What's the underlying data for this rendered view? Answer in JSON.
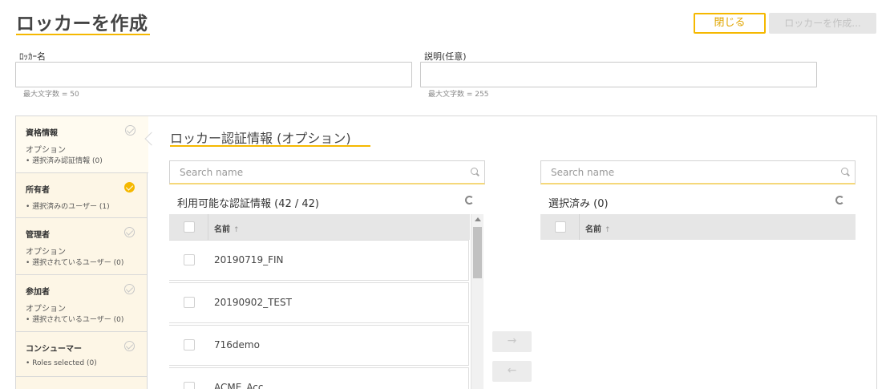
{
  "header": {
    "title": "ロッカーを作成",
    "close_label": "閉じる",
    "create_label": "ロッカーを作成..."
  },
  "form": {
    "name_label": "ﾛｯｶｰ名",
    "name_value": "",
    "name_hint": "最大文字数 = 50",
    "desc_label": "説明(任意)",
    "desc_value": "",
    "desc_hint": "最大文字数 = 255"
  },
  "sidebar": {
    "items": [
      {
        "title": "資格情報",
        "sub": "オプション",
        "detail": "• 選択済み認証情報 (0)",
        "status": "pending"
      },
      {
        "title": "所有者",
        "sub": "",
        "detail": "• 選択済みのユーザー (1)",
        "status": "done"
      },
      {
        "title": "管理者",
        "sub": "オプション",
        "detail": "• 選択されているユーザー (0)",
        "status": "pending"
      },
      {
        "title": "参加者",
        "sub": "オプション",
        "detail": "• 選択されているユーザー (0)",
        "status": "pending"
      },
      {
        "title": "コンシューマー",
        "sub": "",
        "detail": "• Roles selected (0)",
        "status": "pending"
      }
    ]
  },
  "main": {
    "section_title": "ロッカー認証情報 (オプション)",
    "available": {
      "search_placeholder": "Search name",
      "header": "利用可能な認証情報 (42 / 42)",
      "column_name": "名前",
      "rows": [
        "20190719_FIN",
        "20190902_TEST",
        "716demo",
        "ACME_Acc"
      ]
    },
    "selected": {
      "search_placeholder": "Search name",
      "header": "選択済み (0)",
      "column_name": "名前"
    },
    "move_right_label": "→",
    "move_left_label": "←"
  }
}
